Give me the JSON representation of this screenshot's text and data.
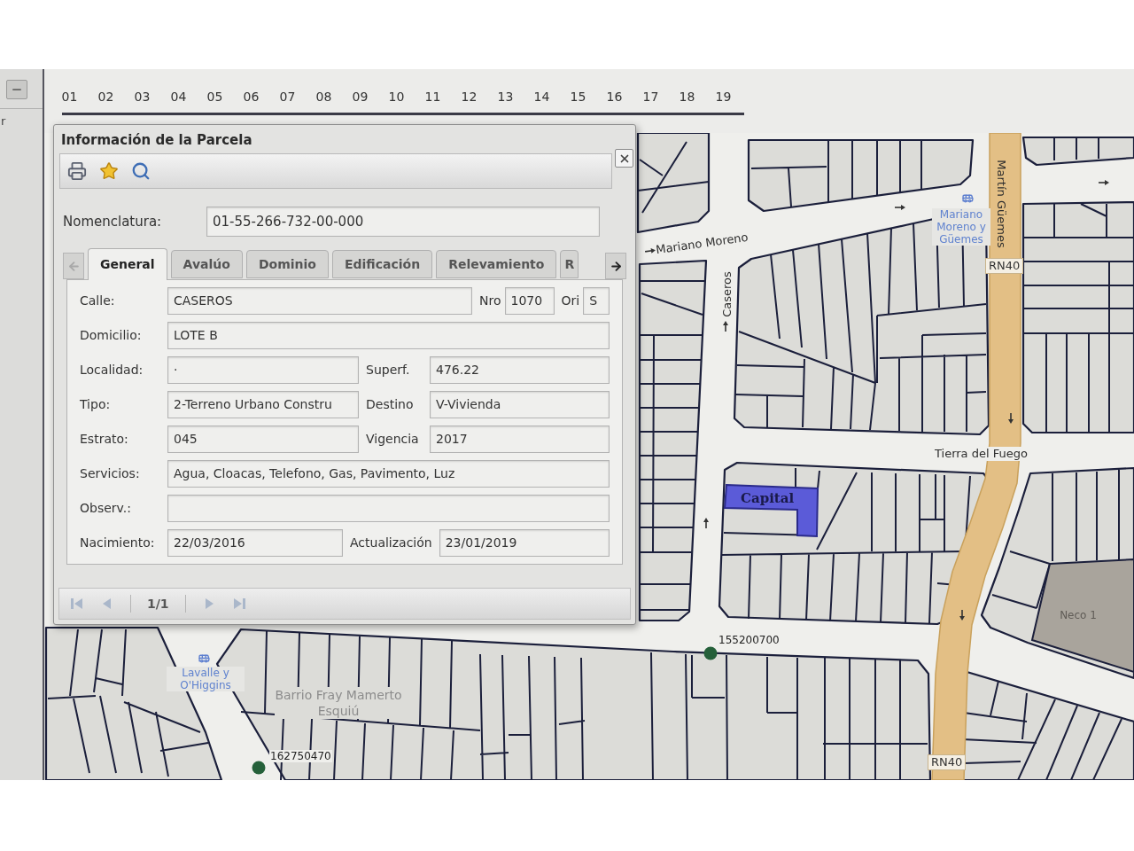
{
  "left_panel": {
    "text": "r"
  },
  "ruler": {
    "numbers": [
      "01",
      "02",
      "03",
      "04",
      "05",
      "06",
      "07",
      "08",
      "09",
      "10",
      "11",
      "12",
      "13",
      "14",
      "15",
      "16",
      "17",
      "18",
      "19"
    ]
  },
  "dialog": {
    "title": "Información de la Parcela",
    "nomenclatura": {
      "label": "Nomenclatura:",
      "value": "01-55-266-732-00-000"
    },
    "tab_scroll": [
      {
        "kind": "left",
        "disabled": true
      },
      {
        "kind": "right",
        "disabled": false
      }
    ],
    "tabs": [
      {
        "label": "General",
        "selected": true
      },
      {
        "label": "Avalúo",
        "selected": false
      },
      {
        "label": "Dominio",
        "selected": false
      },
      {
        "label": "Edificación",
        "selected": false
      },
      {
        "label": "Relevamiento",
        "selected": false
      },
      {
        "label": "R",
        "selected": false
      }
    ],
    "form": {
      "rows": [
        {
          "fields": [
            {
              "label": "Calle:",
              "value": "CASEROS"
            },
            {
              "label": "Nro",
              "value": "1070"
            },
            {
              "label": "Ori",
              "value": "S"
            }
          ]
        },
        {
          "fields": [
            {
              "label": "Domicilio:",
              "value": "LOTE B"
            }
          ]
        },
        {
          "fields": [
            {
              "label": "Localidad:",
              "value": "·"
            },
            {
              "label": "Superf.",
              "value": "476.22"
            }
          ]
        },
        {
          "fields": [
            {
              "label": "Tipo:",
              "value": "2-Terreno Urbano Constru"
            },
            {
              "label": "Destino",
              "value": "V-Vivienda"
            }
          ]
        },
        {
          "fields": [
            {
              "label": "Estrato:",
              "value": "045"
            },
            {
              "label": "Vigencia",
              "value": "2017"
            }
          ]
        },
        {
          "fields": [
            {
              "label": "Servicios:",
              "value": "Agua, Cloacas, Telefono, Gas, Pavimento, Luz"
            }
          ]
        },
        {
          "fields": [
            {
              "label": "Observ.:"
            }
          ]
        },
        {
          "fields": [
            {
              "label": "Nacimiento:",
              "value": "22/03/2016"
            },
            {
              "label": "Actualización",
              "value": "23/01/2019"
            }
          ]
        }
      ]
    },
    "pager": {
      "buttons": [
        {
          "kind": "first",
          "disabled": true
        },
        {
          "kind": "previous",
          "disabled": true
        },
        {
          "kind": "next",
          "disabled": true
        },
        {
          "kind": "last",
          "disabled": true
        }
      ],
      "page": "1/1"
    }
  },
  "map": {
    "streets": [
      "Mariano Moreno",
      "Caseros",
      "Martín Güemes",
      "Tierra del Fuego"
    ],
    "route_badges": [
      "RN40",
      "RN40"
    ],
    "bus_stops": [
      "Mariano Moreno y Güemes",
      "Lavalle y O'Higgins"
    ],
    "areas": [
      "Barrio Fray Mamerto Esquiú",
      "Neco 1"
    ],
    "points": [
      "155200700",
      "162750470"
    ],
    "highlighted_parcel": {
      "label": "Capital"
    }
  }
}
